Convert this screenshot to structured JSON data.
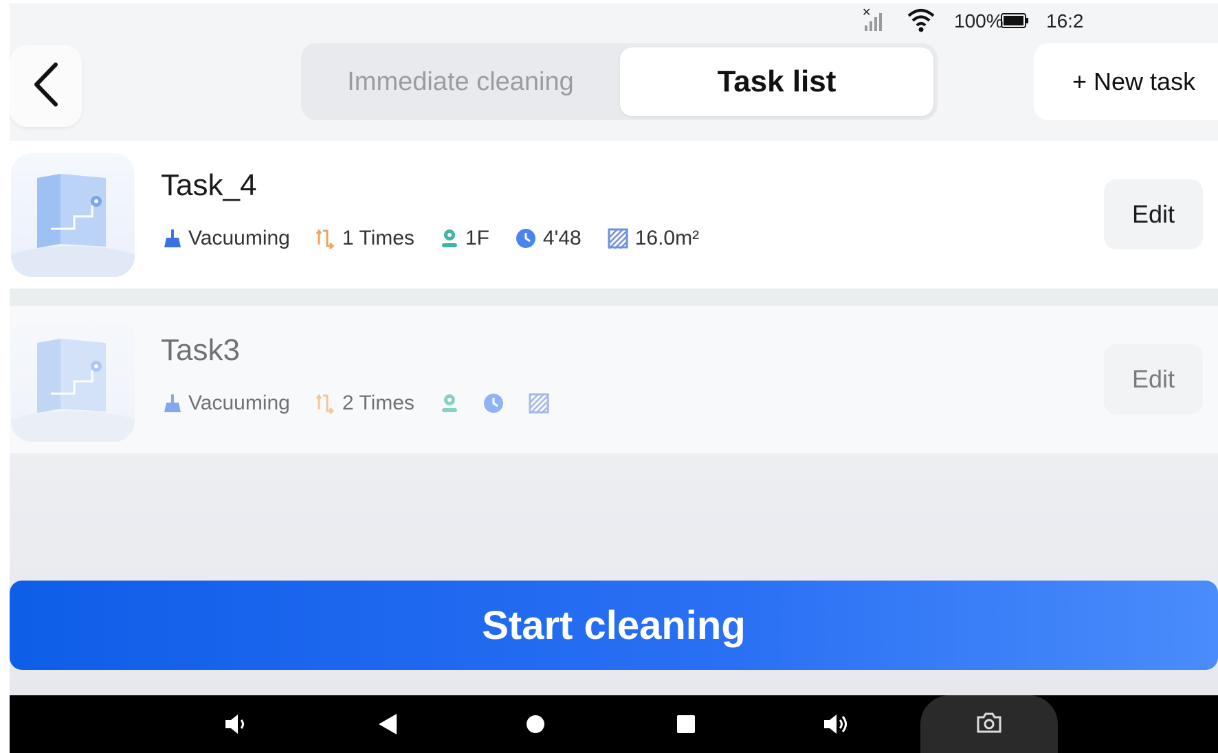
{
  "status_bar": {
    "signal_icon": "no-signal-icon",
    "wifi_icon": "wifi-icon",
    "battery_percent": "100%",
    "battery_icon": "battery-full-icon",
    "time": "16:2"
  },
  "header": {
    "back_icon": "chevron-left-icon",
    "tabs": [
      {
        "label": "Immediate cleaning",
        "active": false
      },
      {
        "label": "Task list",
        "active": true
      }
    ],
    "new_task_label": "+ New task"
  },
  "tasks": [
    {
      "name": "Task_4",
      "mode": "Vacuuming",
      "times": "1 Times",
      "floor": "1F",
      "duration": "4'48",
      "area": "16.0m²",
      "edit_label": "Edit"
    },
    {
      "name": "Task3",
      "mode": "Vacuuming",
      "times": "2 Times",
      "floor": "",
      "duration": "",
      "area": "",
      "edit_label": "Edit"
    }
  ],
  "start_button_label": "Start cleaning",
  "colors": {
    "accent": "#1f66f0",
    "mode_icon": "#3a72e6",
    "times_icon": "#f2a35c",
    "floor_icon": "#3fb6a3",
    "duration_icon": "#4a85ef",
    "area_icon": "#6f8fe0"
  },
  "nav_bar": {
    "icons": [
      "volume-down-icon",
      "back-triangle-icon",
      "home-circle-icon",
      "recents-square-icon",
      "volume-up-icon",
      "camera-icon"
    ]
  }
}
